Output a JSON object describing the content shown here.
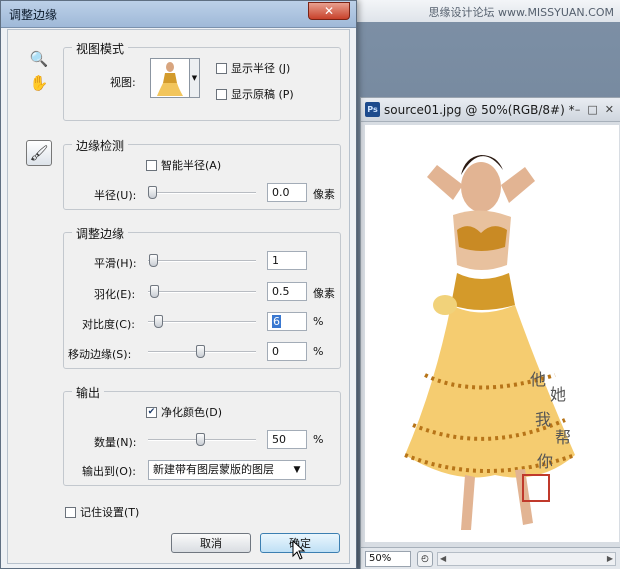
{
  "watermark": "思缘设计论坛 www.MISSYUAN.COM",
  "document": {
    "title": "source01.jpg @ 50%(RGB/8#) *",
    "win_buttons": [
      "–",
      "□",
      "✕"
    ],
    "zoom": "50%",
    "scroll_left": "◀",
    "scroll_right": "▶"
  },
  "dialog": {
    "title": "调整边缘",
    "close": "✕",
    "view_mode": {
      "legend": "视图模式",
      "view_label": "视图:",
      "show_radius": "显示半径 (J)",
      "show_original": "显示原稿 (P)",
      "show_radius_checked": false,
      "show_original_checked": false
    },
    "edge_detection": {
      "legend": "边缘检测",
      "smart_radius": "智能半径(A)",
      "smart_radius_checked": false,
      "radius_label": "半径(U):",
      "radius_value": "0.0",
      "radius_unit": "像素",
      "radius_level": 0
    },
    "adjust_edge": {
      "legend": "调整边缘",
      "smooth_label": "平滑(H):",
      "smooth_value": "1",
      "smooth_level": 0.01,
      "feather_label": "羽化(E):",
      "feather_value": "0.5",
      "feather_unit": "像素",
      "feather_level": 0.02,
      "contrast_label": "对比度(C):",
      "contrast_value": "6",
      "contrast_unit": "%",
      "contrast_level": 0.06,
      "shift_label": "移动边缘(S):",
      "shift_value": "0",
      "shift_unit": "%",
      "shift_level": 0.5
    },
    "output": {
      "legend": "输出",
      "decontaminate": "净化颜色(D)",
      "decontaminate_checked": true,
      "amount_label": "数量(N):",
      "amount_value": "50",
      "amount_unit": "%",
      "amount_level": 0.5,
      "output_to_label": "输出到(O):",
      "output_to_value": "新建带有图层蒙版的图层"
    },
    "remember": "记住设置(T)",
    "remember_checked": false,
    "cancel": "取消",
    "ok": "确定"
  }
}
